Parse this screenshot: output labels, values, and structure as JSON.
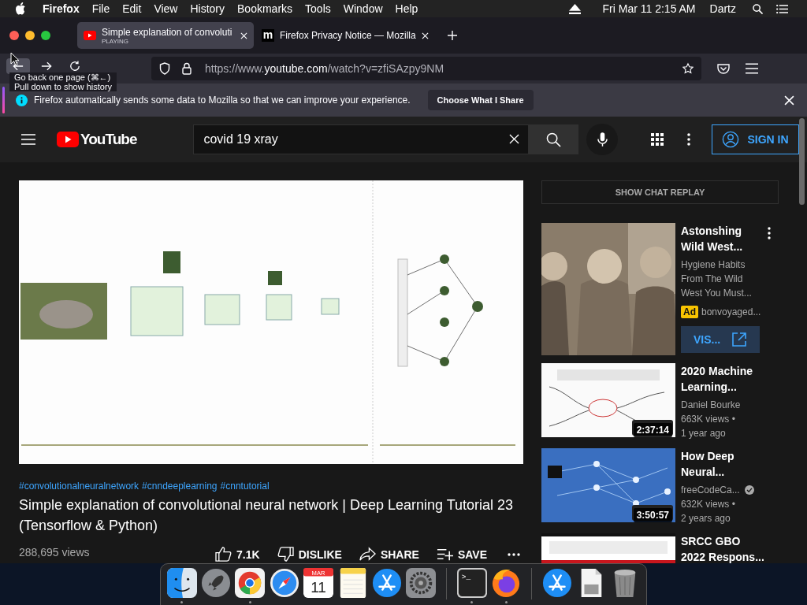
{
  "menu_bar": {
    "app": "Firefox",
    "items": [
      "File",
      "Edit",
      "View",
      "History",
      "Bookmarks",
      "Tools",
      "Window",
      "Help"
    ],
    "clock": "Fri Mar 11  2:15 AM",
    "user": "Dartz"
  },
  "tabs": [
    {
      "kind": "youtube",
      "title": "Simple explanation of convoluti",
      "subtitle": "PLAYING",
      "selected": true
    },
    {
      "kind": "mozilla",
      "icon_text": "m",
      "title": "Firefox Privacy Notice — Mozilla",
      "selected": false
    }
  ],
  "address_bar": {
    "url": "https://www.**youtube.com**/watch?v=zfiSAzpy9NM"
  },
  "tooltip": {
    "lines": [
      "Go back one page (⌘←)",
      "Pull down to show history"
    ]
  },
  "notification": {
    "message": "Firefox automatically sends some data to Mozilla so that we can improve your experience.",
    "button": "Choose What I Share"
  },
  "youtube": {
    "logo": "YouTube",
    "search": {
      "value": "covid 19 xray"
    },
    "sign_in": "SIGN IN"
  },
  "video": {
    "kind": "picture",
    "hashtags": [
      "#convolutionalneuralnetwork",
      "#cnndeeplearning",
      "#cnntutorial"
    ],
    "title": "Simple explanation of convolutional neural network | Deep Learning Tutorial 23 (Tensorflow & Python)",
    "views": "288,695 views",
    "actions": [
      {
        "kind": "like",
        "label": "7.1K"
      },
      {
        "kind": "dislike",
        "label": "DISLIKE"
      },
      {
        "kind": "share",
        "label": "SHARE"
      },
      {
        "kind": "save",
        "label": "SAVE"
      },
      {
        "kind": "more"
      }
    ]
  },
  "sidebar": {
    "chat_button": "SHOW CHAT REPLAY",
    "items": [
      {
        "kind": "ad",
        "title": "Astonshing Wild West...",
        "description": "Hygiene Habits From The Wild West You Must...",
        "badge": "Ad",
        "channel": "bonvoyaged...",
        "button": "VIS..."
      },
      {
        "kind": "video",
        "title": "2020 Machine Learning...",
        "channel": "Daniel Bourke",
        "views": "663K views •",
        "age": "1 year ago",
        "duration": "2:37:14",
        "verified": false
      },
      {
        "kind": "video",
        "title": "How Deep Neural...",
        "channel": "freeCodeCa...",
        "views": "632K views •",
        "age": "2 years ago",
        "duration": "3:50:57",
        "verified": true
      },
      {
        "kind": "video",
        "title": "SRCC GBO 2022 Respons..."
      }
    ]
  },
  "dock": [
    {
      "kind": "finder",
      "running": true
    },
    {
      "kind": "launchpad",
      "running": false
    },
    {
      "kind": "chrome",
      "running": true
    },
    {
      "kind": "safari",
      "running": false
    },
    {
      "kind": "calendar",
      "month": "MAR",
      "day": "11",
      "running": false
    },
    {
      "kind": "notes",
      "running": false
    },
    {
      "kind": "appstore",
      "running": false
    },
    {
      "kind": "settings",
      "running": false
    },
    {
      "kind": "separator"
    },
    {
      "kind": "terminal",
      "prompt": ">_",
      "running": true
    },
    {
      "kind": "firefox",
      "running": true
    },
    {
      "kind": "separator"
    },
    {
      "kind": "appstore",
      "running": false
    },
    {
      "kind": "document",
      "running": false
    },
    {
      "kind": "trash",
      "running": false
    }
  ]
}
